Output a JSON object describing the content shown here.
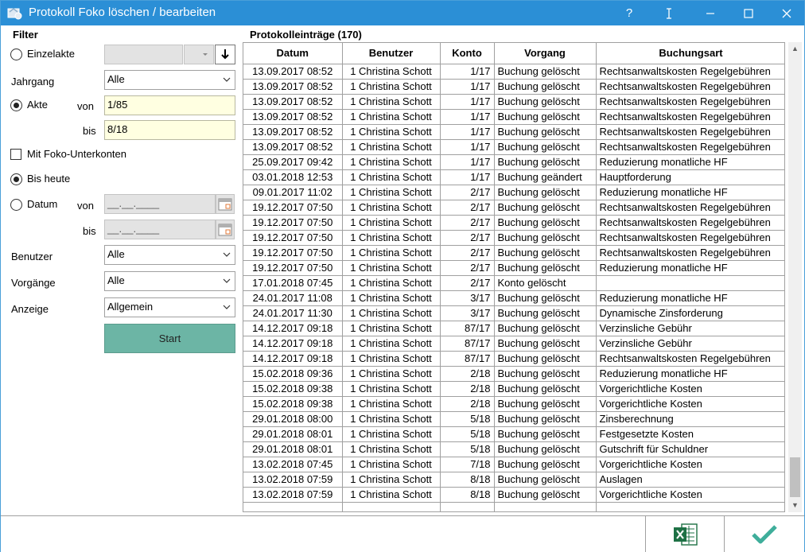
{
  "window": {
    "title": "Protokoll Foko löschen / bearbeiten",
    "help_label": "?",
    "accent_color": "#2b8fd6"
  },
  "filter": {
    "heading": "Filter",
    "einzelakte_label": "Einzelakte",
    "jahrgang_label": "Jahrgang",
    "jahrgang_value": "Alle",
    "akte_label": "Akte",
    "von_label": "von",
    "bis_label": "bis",
    "akte_von": "1/85",
    "akte_bis": "8/18",
    "unterkonten_label": "Mit Foko-Unterkonten",
    "bis_heute_label": "Bis heute",
    "datum_label": "Datum",
    "datum_von_placeholder": "__.__.____",
    "datum_bis_placeholder": "__.__.____",
    "benutzer_label": "Benutzer",
    "benutzer_value": "Alle",
    "vorgaenge_label": "Vorgänge",
    "vorgaenge_value": "Alle",
    "anzeige_label": "Anzeige",
    "anzeige_value": "Allgemein",
    "start_label": "Start",
    "selected_radio": "Akte",
    "unterkonten_checked": false,
    "zeitraum_radio": "Bis heute"
  },
  "list": {
    "heading": "Protokolleinträge (170)",
    "columns": [
      "Datum",
      "Benutzer",
      "Konto",
      "Vorgang",
      "Buchungsart"
    ],
    "rows": [
      [
        "13.09.2017 08:52",
        "1 Christina Schott",
        "1/17",
        "Buchung gelöscht",
        "Rechtsanwaltskosten Regelgebühren"
      ],
      [
        "13.09.2017 08:52",
        "1 Christina Schott",
        "1/17",
        "Buchung gelöscht",
        "Rechtsanwaltskosten Regelgebühren"
      ],
      [
        "13.09.2017 08:52",
        "1 Christina Schott",
        "1/17",
        "Buchung gelöscht",
        "Rechtsanwaltskosten Regelgebühren"
      ],
      [
        "13.09.2017 08:52",
        "1 Christina Schott",
        "1/17",
        "Buchung gelöscht",
        "Rechtsanwaltskosten Regelgebühren"
      ],
      [
        "13.09.2017 08:52",
        "1 Christina Schott",
        "1/17",
        "Buchung gelöscht",
        "Rechtsanwaltskosten Regelgebühren"
      ],
      [
        "13.09.2017 08:52",
        "1 Christina Schott",
        "1/17",
        "Buchung gelöscht",
        "Rechtsanwaltskosten Regelgebühren"
      ],
      [
        "25.09.2017 09:42",
        "1 Christina Schott",
        "1/17",
        "Buchung gelöscht",
        "Reduzierung monatliche HF"
      ],
      [
        "03.01.2018 12:53",
        "1 Christina Schott",
        "1/17",
        "Buchung geändert",
        "Hauptforderung"
      ],
      [
        "09.01.2017 11:02",
        "1 Christina Schott",
        "2/17",
        "Buchung gelöscht",
        "Reduzierung monatliche HF"
      ],
      [
        "19.12.2017 07:50",
        "1 Christina Schott",
        "2/17",
        "Buchung gelöscht",
        "Rechtsanwaltskosten Regelgebühren"
      ],
      [
        "19.12.2017 07:50",
        "1 Christina Schott",
        "2/17",
        "Buchung gelöscht",
        "Rechtsanwaltskosten Regelgebühren"
      ],
      [
        "19.12.2017 07:50",
        "1 Christina Schott",
        "2/17",
        "Buchung gelöscht",
        "Rechtsanwaltskosten Regelgebühren"
      ],
      [
        "19.12.2017 07:50",
        "1 Christina Schott",
        "2/17",
        "Buchung gelöscht",
        "Rechtsanwaltskosten Regelgebühren"
      ],
      [
        "19.12.2017 07:50",
        "1 Christina Schott",
        "2/17",
        "Buchung gelöscht",
        "Reduzierung monatliche HF"
      ],
      [
        "17.01.2018 07:45",
        "1 Christina Schott",
        "2/17",
        "Konto gelöscht",
        ""
      ],
      [
        "24.01.2017 11:08",
        "1 Christina Schott",
        "3/17",
        "Buchung gelöscht",
        "Reduzierung monatliche HF"
      ],
      [
        "24.01.2017 11:30",
        "1 Christina Schott",
        "3/17",
        "Buchung gelöscht",
        "Dynamische Zinsforderung"
      ],
      [
        "14.12.2017 09:18",
        "1 Christina Schott",
        "87/17",
        "Buchung gelöscht",
        "Verzinsliche Gebühr"
      ],
      [
        "14.12.2017 09:18",
        "1 Christina Schott",
        "87/17",
        "Buchung gelöscht",
        "Verzinsliche Gebühr"
      ],
      [
        "14.12.2017 09:18",
        "1 Christina Schott",
        "87/17",
        "Buchung gelöscht",
        "Rechtsanwaltskosten Regelgebühren"
      ],
      [
        "15.02.2018 09:36",
        "1 Christina Schott",
        "2/18",
        "Buchung gelöscht",
        "Reduzierung monatliche HF"
      ],
      [
        "15.02.2018 09:38",
        "1 Christina Schott",
        "2/18",
        "Buchung gelöscht",
        "Vorgerichtliche Kosten"
      ],
      [
        "15.02.2018 09:38",
        "1 Christina Schott",
        "2/18",
        "Buchung gelöscht",
        "Vorgerichtliche Kosten"
      ],
      [
        "29.01.2018 08:00",
        "1 Christina Schott",
        "5/18",
        "Buchung gelöscht",
        "Zinsberechnung"
      ],
      [
        "29.01.2018 08:01",
        "1 Christina Schott",
        "5/18",
        "Buchung gelöscht",
        "Festgesetzte Kosten"
      ],
      [
        "29.01.2018 08:01",
        "1 Christina Schott",
        "5/18",
        "Buchung gelöscht",
        "Gutschrift für Schuldner"
      ],
      [
        "13.02.2018 07:45",
        "1 Christina Schott",
        "7/18",
        "Buchung gelöscht",
        "Vorgerichtliche Kosten"
      ],
      [
        "13.02.2018 07:59",
        "1 Christina Schott",
        "8/18",
        "Buchung gelöscht",
        "Auslagen"
      ],
      [
        "13.02.2018 07:59",
        "1 Christina Schott",
        "8/18",
        "Buchung gelöscht",
        "Vorgerichtliche Kosten"
      ]
    ]
  },
  "footer": {
    "excel_icon": "excel-export-icon",
    "ok_icon": "checkmark-icon",
    "ok_color": "#3fae9b"
  }
}
